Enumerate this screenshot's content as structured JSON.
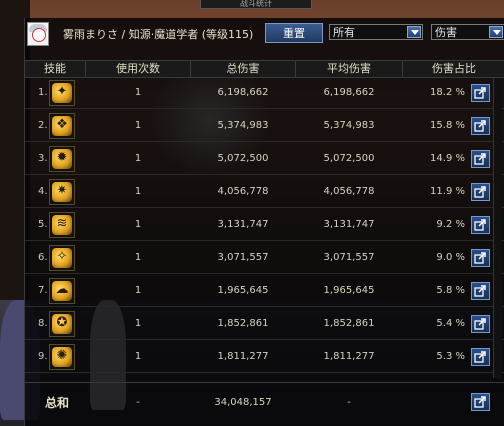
{
  "window": {
    "title": "战斗统计"
  },
  "header": {
    "player_name": "雾雨まりさ / 知源·魔道学者 (等级115)",
    "reset_label": "重置",
    "filter_target": "所有",
    "filter_metric": "伤害"
  },
  "columns": {
    "skill": "技能",
    "count": "使用次数",
    "total": "总伤害",
    "avg": "平均伤害",
    "share": "伤害占比"
  },
  "rows": [
    {
      "num": "1.",
      "icon": "skill-icon-1",
      "count": "1",
      "total": "6,198,662",
      "avg": "6,198,662",
      "pct": "18.2 %"
    },
    {
      "num": "2.",
      "icon": "skill-icon-2",
      "count": "1",
      "total": "5,374,983",
      "avg": "5,374,983",
      "pct": "15.8 %"
    },
    {
      "num": "3.",
      "icon": "skill-icon-3",
      "count": "1",
      "total": "5,072,500",
      "avg": "5,072,500",
      "pct": "14.9 %"
    },
    {
      "num": "4.",
      "icon": "skill-icon-4",
      "count": "1",
      "total": "4,056,778",
      "avg": "4,056,778",
      "pct": "11.9 %"
    },
    {
      "num": "5.",
      "icon": "skill-icon-5",
      "count": "1",
      "total": "3,131,747",
      "avg": "3,131,747",
      "pct": "9.2 %"
    },
    {
      "num": "6.",
      "icon": "skill-icon-6",
      "count": "1",
      "total": "3,071,557",
      "avg": "3,071,557",
      "pct": "9.0 %"
    },
    {
      "num": "7.",
      "icon": "skill-icon-7",
      "count": "1",
      "total": "1,965,645",
      "avg": "1,965,645",
      "pct": "5.8 %"
    },
    {
      "num": "8.",
      "icon": "skill-icon-8",
      "count": "1",
      "total": "1,852,861",
      "avg": "1,852,861",
      "pct": "5.4 %"
    },
    {
      "num": "9.",
      "icon": "skill-icon-9",
      "count": "1",
      "total": "1,811,277",
      "avg": "1,811,277",
      "pct": "5.3 %"
    }
  ],
  "summary": {
    "label": "总和",
    "count": "-",
    "total": "34,048,157",
    "avg": "-"
  },
  "colors": {
    "panel_bg": "#060608",
    "accent_blue": "#2a4f8a",
    "icon_gold": "#e0a020",
    "text": "#d8d2c0"
  }
}
